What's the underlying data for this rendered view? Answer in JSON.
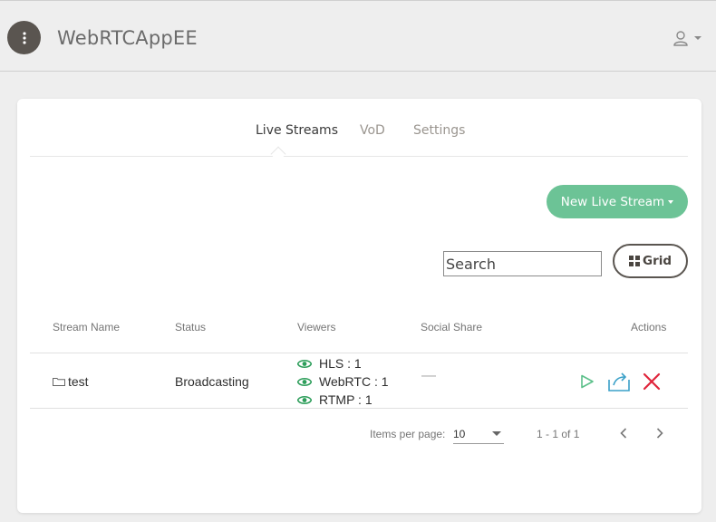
{
  "app": {
    "title": "WebRTCAppEE"
  },
  "tabs": [
    {
      "label": "Live Streams",
      "active": true
    },
    {
      "label": "VoD",
      "active": false
    },
    {
      "label": "Settings",
      "active": false
    }
  ],
  "toolbar": {
    "new_stream_label": "New Live Stream",
    "search_placeholder": "Search",
    "grid_label": "Grid"
  },
  "table": {
    "headers": [
      "Stream Name",
      "Status",
      "Viewers",
      "Social Share",
      "Actions"
    ],
    "rows": [
      {
        "name": "test",
        "status": "Broadcasting",
        "viewers": [
          "HLS : 1",
          "WebRTC : 1",
          "RTMP : 1"
        ],
        "social_share": "—"
      }
    ]
  },
  "paginator": {
    "items_per_page_label": "Items per page:",
    "page_size": "10",
    "range": "1 - 1 of 1"
  },
  "colors": {
    "accent_green": "#6cc396",
    "icon_green": "#2e9e5b",
    "delete_red": "#e0243b",
    "share_blue": "#3aa0c8"
  }
}
